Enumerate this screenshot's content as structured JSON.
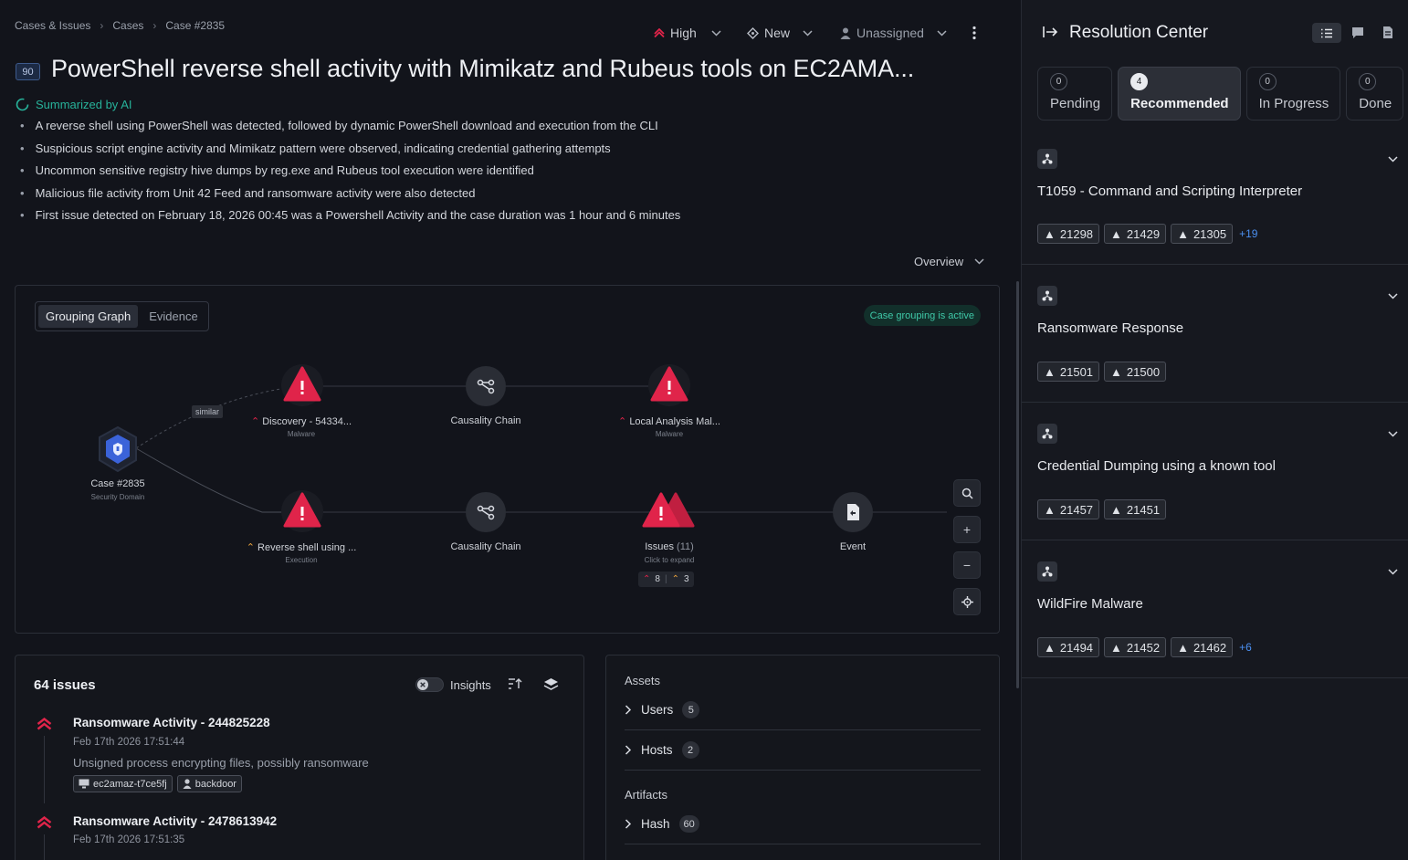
{
  "breadcrumb": [
    "Cases & Issues",
    "Cases",
    "Case #2835"
  ],
  "header_controls": {
    "severity": "High",
    "status": "New",
    "assignee": "Unassigned"
  },
  "case": {
    "score": "90",
    "title": "PowerShell reverse shell activity with Mimikatz and Rubeus tools on EC2AMA...",
    "ai_label": "Summarized by AI",
    "summary": [
      "A reverse shell using PowerShell was detected, followed by dynamic PowerShell download and execution from the CLI",
      "Suspicious script engine activity and Mimikatz pattern were observed, indicating credential gathering attempts",
      "Uncommon sensitive registry hive dumps by reg.exe and Rubeus tool execution were identified",
      "Malicious file activity from Unit 42 Feed and ransomware activity were also detected",
      "First issue detected on February 18, 2026 00:45 was a Powershell Activity and the case duration was 1 hour and 6 minutes"
    ]
  },
  "overview_select": "Overview",
  "graph": {
    "tabs": [
      "Grouping Graph",
      "Evidence"
    ],
    "status_badge": "Case grouping is active",
    "similar_label": "similar",
    "nodes": {
      "case": {
        "label": "Case #2835",
        "sub": "Security Domain"
      },
      "discovery": {
        "label": "Discovery - 54334...",
        "sub": "Malware"
      },
      "chain1": {
        "label": "Causality Chain"
      },
      "local": {
        "label": "Local Analysis Mal...",
        "sub": "Malware"
      },
      "reverse": {
        "label": "Reverse shell using ...",
        "sub": "Execution"
      },
      "chain2": {
        "label": "Causality Chain"
      },
      "issues": {
        "label": "Issues",
        "count": "(11)",
        "sub": "Click to expand",
        "high": "8",
        "medium": "3"
      },
      "event": {
        "label": "Event"
      }
    }
  },
  "issues_panel": {
    "title": "64 issues",
    "insights_label": "Insights",
    "items": [
      {
        "title": "Ransomware Activity - 244825228",
        "time": "Feb 17th 2026 17:51:44",
        "desc": "Unsigned process encrypting files, possibly ransomware",
        "host": "ec2amaz-t7ce5fj",
        "user": "backdoor"
      },
      {
        "title": "Ransomware Activity - 2478613942",
        "time": "Feb 17th 2026 17:51:35"
      }
    ]
  },
  "assets_panel": {
    "assets_title": "Assets",
    "rows": [
      {
        "label": "Users",
        "count": "5"
      },
      {
        "label": "Hosts",
        "count": "2"
      }
    ],
    "artifacts_title": "Artifacts",
    "artifact_rows": [
      {
        "label": "Hash",
        "count": "60"
      }
    ]
  },
  "resolution_center": {
    "title": "Resolution Center",
    "tabs": [
      {
        "count": "0",
        "label": "Pending"
      },
      {
        "count": "4",
        "label": "Recommended"
      },
      {
        "count": "0",
        "label": "In Progress"
      },
      {
        "count": "0",
        "label": "Done"
      }
    ],
    "cards": [
      {
        "name": "T1059 - Command and Scripting Interpreter",
        "chips": [
          "21298",
          "21429",
          "21305"
        ],
        "more": "+19"
      },
      {
        "name": "Ransomware Response",
        "chips": [
          "21501",
          "21500"
        ],
        "more": ""
      },
      {
        "name": "Credential Dumping using a known tool",
        "chips": [
          "21457",
          "21451"
        ],
        "more": ""
      },
      {
        "name": "WildFire Malware",
        "chips": [
          "21494",
          "21452",
          "21462"
        ],
        "more": "+6"
      }
    ]
  },
  "colors": {
    "accent_teal": "#27b29a",
    "alert_red": "#e0244a",
    "link_blue": "#4b8ff0",
    "case_blue": "#3b63d9"
  }
}
